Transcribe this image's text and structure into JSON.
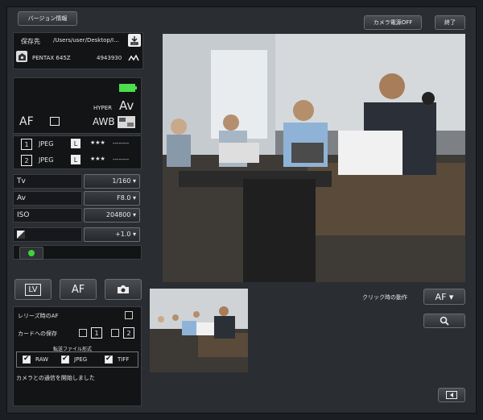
{
  "header": {
    "version_btn": "バージョン情報",
    "power_off_btn": "カメラ電源OFF",
    "exit_btn": "終了"
  },
  "save": {
    "label": "保存先",
    "path": "/Users/user/Desktop/I..."
  },
  "camera": {
    "model": "PENTAX 645Z",
    "serial": "4943930"
  },
  "status": {
    "hyper": "HYPER",
    "mode": "Av",
    "focus": "AF",
    "wb": "AWB"
  },
  "slots": [
    {
      "num": "1",
      "format": "JPEG",
      "size": "L",
      "quality": "★★★",
      "remain": "--------"
    },
    {
      "num": "2",
      "format": "JPEG",
      "size": "L",
      "quality": "★★★",
      "remain": "--------"
    }
  ],
  "exposure": [
    {
      "label": "Tv",
      "value": "1/160"
    },
    {
      "label": "Av",
      "value": "F8.0"
    },
    {
      "label": "ISO",
      "value": "204800"
    },
    {
      "label": "",
      "value": "+1.0"
    }
  ],
  "controls": {
    "lv": "LV",
    "af": "AF"
  },
  "options": {
    "release_af": "レリーズ時のAF",
    "card_save": "カードへの保存",
    "card1": "1",
    "card2": "2",
    "transfer_title": "転送ファイル形式",
    "raw": "RAW",
    "jpeg": "JPEG",
    "tiff": "TIFF"
  },
  "message": "カメラとの通信を開始しました",
  "click_action": {
    "label": "クリック時の動作",
    "value": "AF"
  },
  "colors": {
    "battery": "#4ddc4d",
    "panel": "#121416",
    "accent": "#f2f2f2"
  }
}
